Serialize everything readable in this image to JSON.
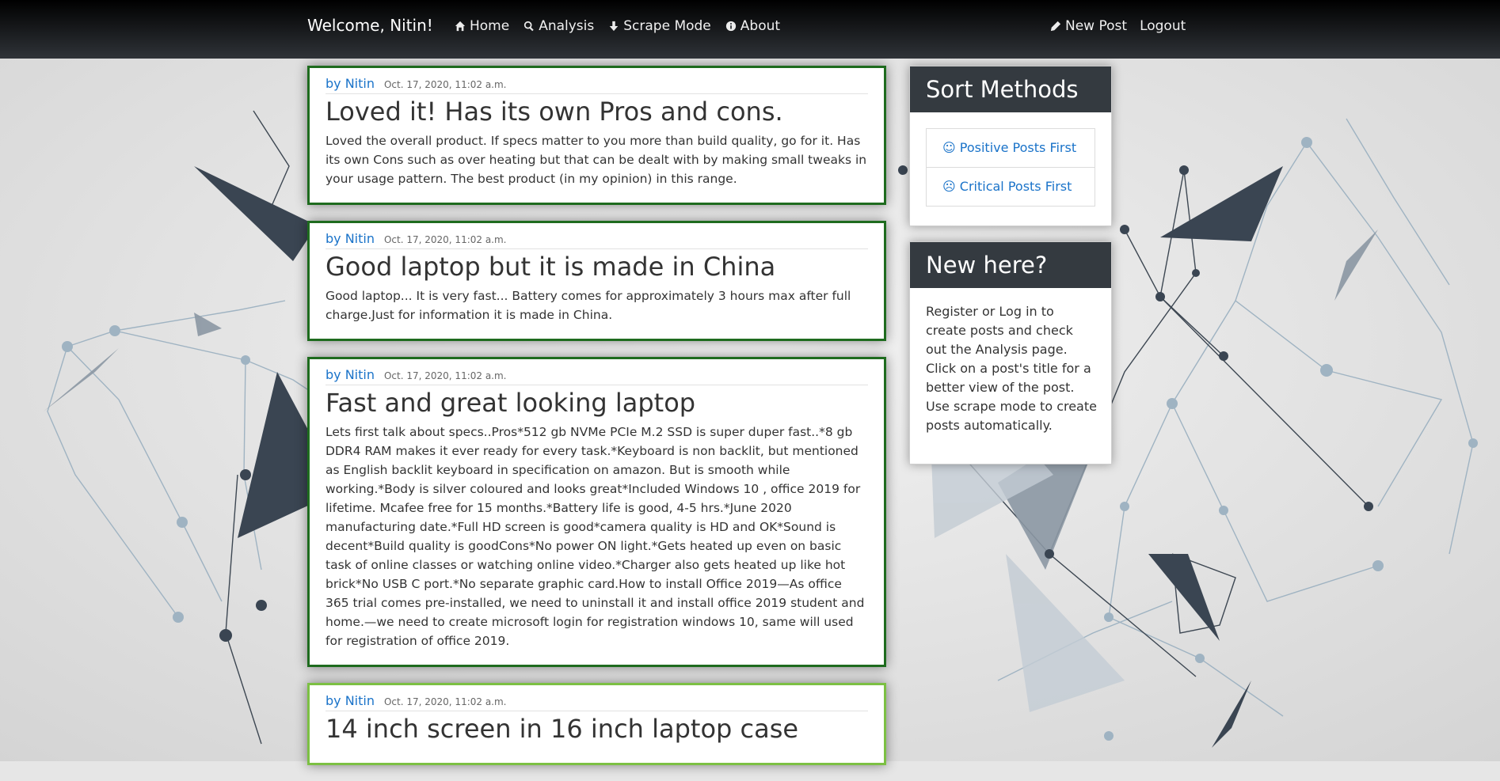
{
  "navbar": {
    "brand": "Welcome, Nitin!",
    "links": [
      {
        "label": "Home",
        "icon": "home-icon"
      },
      {
        "label": "Analysis",
        "icon": "search-icon"
      },
      {
        "label": "Scrape Mode",
        "icon": "arrow-down-icon"
      },
      {
        "label": "About",
        "icon": "info-icon"
      }
    ],
    "right": [
      {
        "label": "New Post",
        "icon": "pencil-icon"
      },
      {
        "label": "Logout"
      }
    ]
  },
  "posts": [
    {
      "author": "by Nitin",
      "date": "Oct. 17, 2020, 11:02 a.m.",
      "title": "Loved it! Has its own Pros and cons.",
      "body": "Loved the overall product. If specs matter to you more than build quality, go for it. Has its own Cons such as over heating but that can be dealt with by making small tweaks in your usage pattern. The best product (in my opinion) in this range."
    },
    {
      "author": "by Nitin",
      "date": "Oct. 17, 2020, 11:02 a.m.",
      "title": "Good laptop but it is made in China",
      "body": "Good laptop... It is very fast... Battery comes for approximately 3 hours max after full charge.Just for information it is made in China."
    },
    {
      "author": "by Nitin",
      "date": "Oct. 17, 2020, 11:02 a.m.",
      "title": "Fast and great looking laptop",
      "body": "Lets first talk about specs..Pros*512 gb NVMe PCIe M.2 SSD is super duper fast..*8 gb DDR4 RAM makes it ever ready for every task.*Keyboard is non backlit, but mentioned as English backlit keyboard in specification on amazon. But is smooth while working.*Body is silver coloured and looks great*Included Windows 10 , office 2019 for lifetime. Mcafee free for 15 months.*Battery life is good, 4-5 hrs.*June 2020 manufacturing date.*Full HD screen is good*camera quality is HD and OK*Sound is decent*Build quality is goodCons*No power ON light.*Gets heated up even on basic task of online classes or watching online video.*Charger also gets heated up like hot brick*No USB C port.*No separate graphic card.How to install Office 2019—As office 365 trial comes pre-installed, we need to uninstall it and install office 2019 student and home.—we need to create microsoft login for registration windows 10, same will used for registration of office 2019."
    },
    {
      "author": "by Nitin",
      "date": "Oct. 17, 2020, 11:02 a.m.",
      "title": "14 inch screen in 16 inch laptop case",
      "body": ""
    }
  ],
  "sidebar": {
    "sort_title": "Sort Methods",
    "sort_items": [
      {
        "label": "Positive Posts First",
        "icon": "smile-icon"
      },
      {
        "label": "Critical Posts First",
        "icon": "frown-icon"
      }
    ],
    "new_title": "New here?",
    "new_text": "Register or Log in to create posts and check out the Analysis page. Click on a post's title for a better view of the post. Use scrape mode to create posts automatically."
  },
  "colors": {
    "navbar": "#1a1d20",
    "link": "#1a73c9",
    "post_border_dark": "#1e6b1e",
    "post_border_light": "#7cc043",
    "card_header": "#343a40"
  }
}
